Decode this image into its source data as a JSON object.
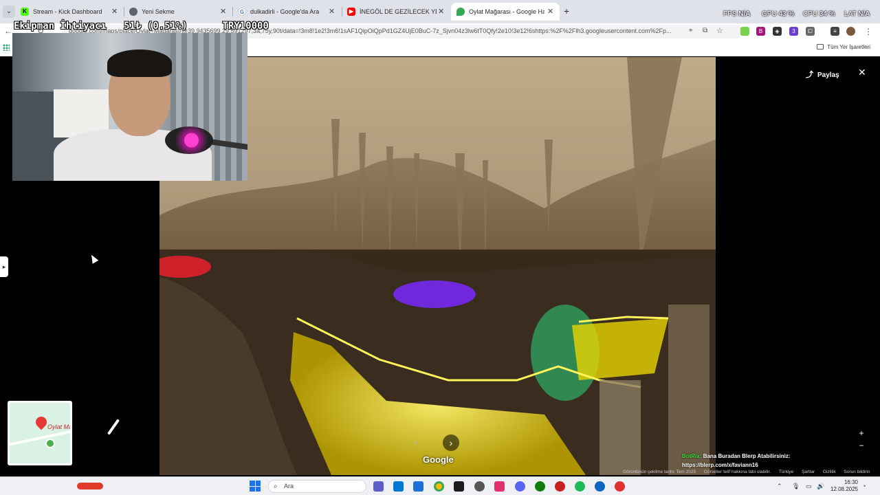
{
  "tabs": [
    {
      "title": "Stream - Kick Dashboard",
      "icon": "kick-icon"
    },
    {
      "title": "Yeni Sekme",
      "icon": "chrome-icon"
    },
    {
      "title": "dulkadirli - Google'da Ara",
      "icon": "google-icon"
    },
    {
      "title": "İNEGÖL DE GEZİLECEK YERLER",
      "icon": "youtube-icon"
    },
    {
      "title": "Oylat Mağarası - Google Harit...",
      "icon": "maps-icon",
      "active": true
    }
  ],
  "hud": {
    "fps_label": "FPS",
    "fps_value": "N/A",
    "gpu_label": "GPU",
    "gpu_value": "43 %",
    "cpu_label": "CPU",
    "cpu_value": "34 %",
    "lat_label": "LAT",
    "lat_value": "N/A"
  },
  "address": {
    "url": "google.com/maps/place/Oylat+Mağarası/@39.9435699,29.591297,3a,75y,90t/data=!3m8!1e2!3m6!1sAF1QipOiQpPd1GZ4UjE0BuC-7z_Sjvn04z3lw6tT0Qfy!2e10!3e12!6shttps:%2F%2Flh3.googleusercontent.com%2Fp..."
  },
  "bookmarks": {
    "all_label": "Tüm Yer İşaretleri"
  },
  "stream_overlay": {
    "text": "Ekipman İhtiyacı   51₺ (0.51%)      TRY10000"
  },
  "viewer": {
    "share_label": "Paylaş",
    "close_symbol": "✕",
    "watermark": "Google",
    "minimap_label": "Oylat Ma",
    "blerp_line1_tag": "BotRix:",
    "blerp_line1": "Bana Buradan Blerp Atabilirsiniz:",
    "blerp_line2": "https://blerp.com/x/faviann16",
    "footer": [
      "Görüntünün çekilme tarihi: Tem 2025",
      "Görseller telif hakkına tabi olabilir.",
      "Türkiye",
      "Şartlar",
      "Gizlilik",
      "Sorun bildirin"
    ]
  },
  "taskbar": {
    "search_placeholder": "Ara",
    "time": "16:30",
    "date": "12.08.2025"
  },
  "colors": {
    "accent": "#1a73e8",
    "scene_yellow": "#f5e000",
    "scene_purple": "#7a28ff",
    "scene_green": "#2bd67b"
  }
}
